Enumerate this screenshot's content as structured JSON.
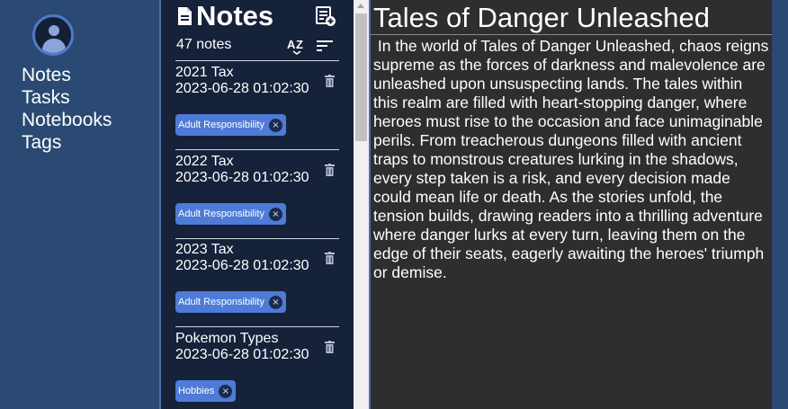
{
  "sidebar": {
    "avatar_icon": "user-avatar-icon",
    "items": [
      {
        "label": "Notes"
      },
      {
        "label": "Tasks"
      },
      {
        "label": "Notebooks"
      },
      {
        "label": "Tags"
      }
    ]
  },
  "notes_panel": {
    "title": "Notes",
    "title_icon": "document-icon",
    "new_note_icon": "new-note-icon",
    "count": "47 notes",
    "sort_alpha_icon": "sort-alphabetical-icon",
    "sort_icon": "sort-lines-icon",
    "notes": [
      {
        "title": "2021 Tax",
        "date": "2023-06-28 01:02:30",
        "tag": "Adult Responsibility"
      },
      {
        "title": "2022 Tax",
        "date": "2023-06-28 01:02:30",
        "tag": "Adult Responsibility"
      },
      {
        "title": "2023 Tax",
        "date": "2023-06-28 01:02:30",
        "tag": "Adult Responsibility"
      },
      {
        "title": "Pokemon Types",
        "date": "2023-06-28 01:02:30",
        "tag": "Hobbies"
      }
    ],
    "tag_remove_glyph": "×"
  },
  "editor": {
    "title": "Tales of Danger Unleashed",
    "body": " In the world of Tales of Danger Unleashed, chaos reigns supreme as the forces of darkness and malevolence are unleashed upon unsuspecting lands. The tales within this realm are filled with heart-stopping danger, where heroes must rise to the occasion and face unimaginable perils. From treacherous dungeons filled with ancient traps to monstrous creatures lurking in the shadows, every step taken is a risk, and every decision made could mean life or death. As the stories unfold, the tension builds, drawing readers into a thrilling adventure where danger lurks at every turn, leaving them on the edge of their seats, eagerly awaiting the heroes' triumph or demise."
  },
  "colors": {
    "sidebar_bg": "#2a4a73",
    "notes_bg": "#16213a",
    "editor_bg": "#2e2e2e",
    "tag_bg": "#4e7bd6",
    "accent": "#4f79c9"
  }
}
